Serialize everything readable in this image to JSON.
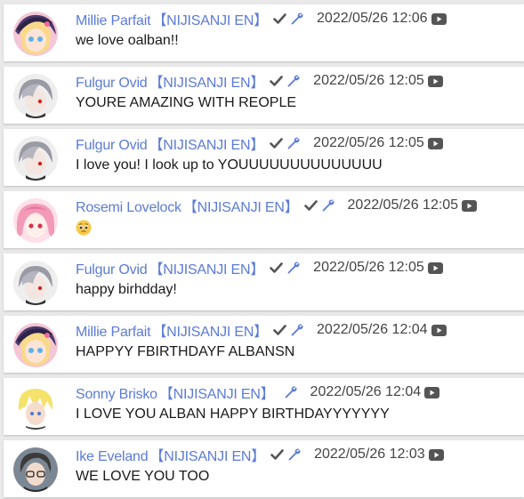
{
  "chat": {
    "messages": [
      {
        "author": "Millie Parfait",
        "tag": "【NIJISANJI EN】",
        "check_icon": true,
        "wrench_icon": true,
        "timestamp": "2022/05/26 12:06",
        "text": "we love oalban!!",
        "avatar": "millie"
      },
      {
        "author": "Fulgur Ovid",
        "tag": "【NIJISANJI EN】",
        "check_icon": true,
        "wrench_icon": true,
        "timestamp": "2022/05/26 12:05",
        "text": "YOURE AMAZING WITH REOPLE",
        "avatar": "fulgur"
      },
      {
        "author": "Fulgur Ovid",
        "tag": "【NIJISANJI EN】",
        "check_icon": true,
        "wrench_icon": true,
        "timestamp": "2022/05/26 12:05",
        "text": "I love you! I look up to YOUUUUUUUUUUUUUU",
        "avatar": "fulgur"
      },
      {
        "author": "Rosemi Lovelock",
        "tag": "【NIJISANJI EN】",
        "check_icon": true,
        "wrench_icon": true,
        "timestamp": "2022/05/26 12:05",
        "text": "",
        "emoji": "pleading-face-emoji",
        "avatar": "rosemi"
      },
      {
        "author": "Fulgur Ovid",
        "tag": "【NIJISANJI EN】",
        "check_icon": true,
        "wrench_icon": true,
        "timestamp": "2022/05/26 12:05",
        "text": "happy birhdday!",
        "avatar": "fulgur"
      },
      {
        "author": "Millie Parfait",
        "tag": "【NIJISANJI EN】",
        "check_icon": true,
        "wrench_icon": true,
        "timestamp": "2022/05/26 12:04",
        "text": "HAPPYY FBIRTHDAYF ALBANSN",
        "avatar": "millie"
      },
      {
        "author": "Sonny Brisko",
        "tag": "【NIJISANJI EN】",
        "check_icon": false,
        "wrench_icon": true,
        "timestamp": "2022/05/26 12:04",
        "text": "I LOVE YOU ALBAN HAPPY BIRTHDAYYYYYYY",
        "avatar": "sonny"
      },
      {
        "author": "Ike Eveland",
        "tag": "【NIJISANJI EN】",
        "check_icon": true,
        "wrench_icon": true,
        "timestamp": "2022/05/26 12:03",
        "text": "WE LOVE YOU TOO",
        "avatar": "ike"
      }
    ],
    "colors": {
      "author": "#5b7bd5",
      "timestamp": "#444444",
      "text": "#1a1a1a",
      "background": "#e9e9e9",
      "card": "#ffffff"
    }
  }
}
